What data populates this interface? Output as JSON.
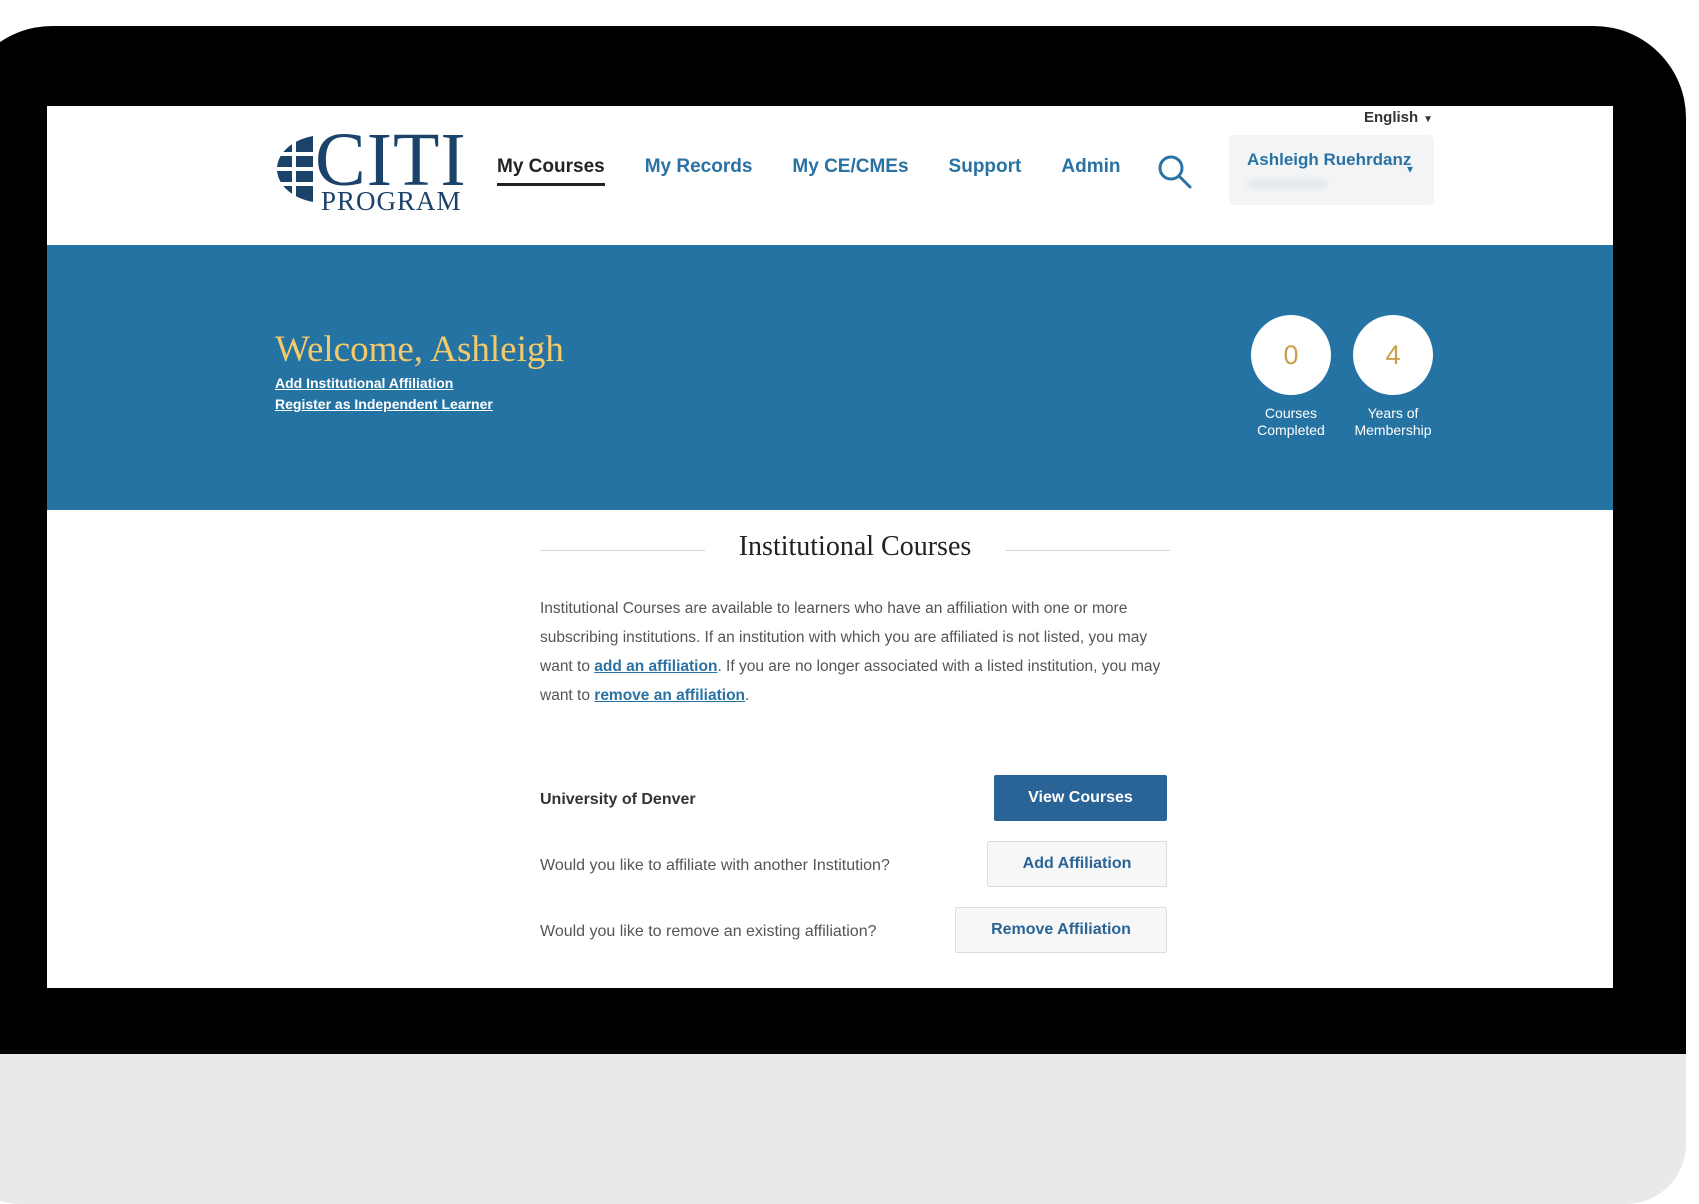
{
  "header": {
    "language": "English",
    "logo": {
      "main": "CITI",
      "sub": "PROGRAM"
    },
    "nav": [
      {
        "label": "My Courses",
        "active": true
      },
      {
        "label": "My Records",
        "active": false
      },
      {
        "label": "My CE/CMEs",
        "active": false
      },
      {
        "label": "Support",
        "active": false
      },
      {
        "label": "Admin",
        "active": false
      }
    ],
    "user": {
      "name": "Ashleigh Ruehrdanz"
    }
  },
  "banner": {
    "welcome": "Welcome, Ashleigh",
    "links": {
      "add_affiliation": "Add Institutional Affiliation",
      "register_independent": "Register as Independent Learner"
    },
    "stats": [
      {
        "value": "0",
        "label_line1": "Courses",
        "label_line2": "Completed"
      },
      {
        "value": "4",
        "label_line1": "Years of",
        "label_line2": "Membership"
      }
    ]
  },
  "institutional": {
    "title": "Institutional Courses",
    "desc_part1": "Institutional Courses are available to learners who have an affiliation with one or more subscribing institutions. If an institution with which you are affiliated is not listed, you may want to ",
    "desc_link1": "add an affiliation",
    "desc_part2": ". If you are no longer associated with a listed institution, you may want to ",
    "desc_link2": "remove an affiliation",
    "desc_part3": ".",
    "institution_name": "University of Denver",
    "view_courses_label": "View Courses",
    "affiliate_question": "Would you like to affiliate with another Institution?",
    "add_affiliation_label": "Add Affiliation",
    "remove_question": "Would you like to remove an existing affiliation?",
    "remove_affiliation_label": "Remove Affiliation"
  },
  "colors": {
    "brand_navy": "#1b4369",
    "banner_blue": "#2573a2",
    "link_blue": "#2a72a4",
    "welcome_gold": "#f4c96a",
    "primary_button": "#2a6496"
  }
}
